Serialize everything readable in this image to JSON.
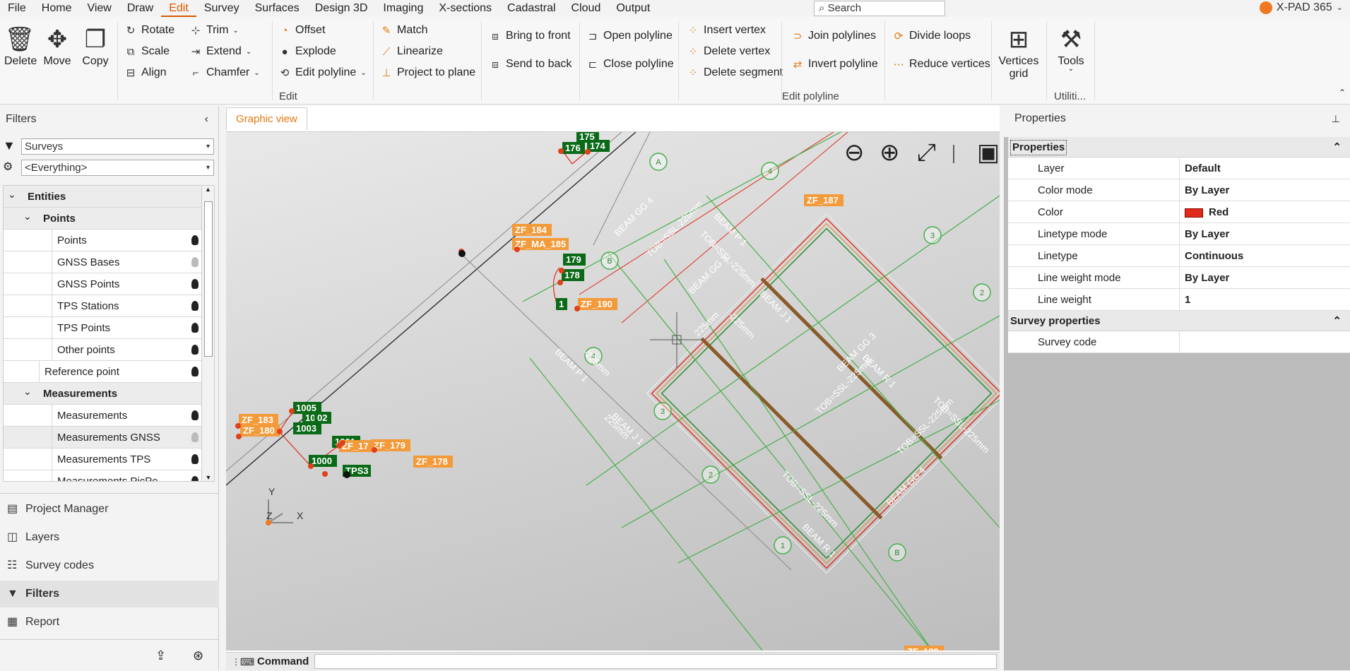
{
  "menu": [
    "File",
    "Home",
    "View",
    "Draw",
    "Edit",
    "Survey",
    "Surfaces",
    "Design 3D",
    "Imaging",
    "X-sections",
    "Cadastral",
    "Cloud",
    "Output"
  ],
  "search_label": "Search",
  "brand": "X-PAD 365",
  "ribbon": {
    "delete": "Delete",
    "move": "Move",
    "copy": "Copy",
    "rotate": "Rotate",
    "scale": "Scale",
    "align": "Align",
    "trim": "Trim",
    "extend": "Extend",
    "chamfer": "Chamfer",
    "offset": "Offset",
    "explode": "Explode",
    "edit_polyline": "Edit polyline",
    "match": "Match",
    "linearize": "Linearize",
    "project_to_plane": "Project to plane",
    "bring_to_front": "Bring to front",
    "send_to_back": "Send to back",
    "open_polyline": "Open polyline",
    "close_polyline": "Close polyline",
    "insert_vertex": "Insert vertex",
    "delete_vertex": "Delete vertex",
    "delete_segment": "Delete segment",
    "join_polylines": "Join polylines",
    "invert_polyline": "Invert polyline",
    "divide_loops": "Divide loops",
    "reduce_vertices": "Reduce vertices",
    "vertices_grid_1": "Vertices",
    "vertices_grid_2": "grid",
    "tools": "Tools",
    "group_edit": "Edit",
    "group_edit_polyline": "Edit polyline",
    "group_utilities": "Utiliti..."
  },
  "filters": {
    "title": "Filters",
    "dropdown1": "Surveys",
    "dropdown2": "<Everything>",
    "tree": [
      {
        "label": "Entities",
        "level": 0,
        "bold": true,
        "expander": true,
        "bulb": "",
        "grey": true
      },
      {
        "label": "Points",
        "level": 1,
        "bold": true,
        "expander": true,
        "bulb": "",
        "grey": true
      },
      {
        "label": "Points",
        "level": 2,
        "bold": false,
        "expander": false,
        "bulb": "on",
        "grey": false
      },
      {
        "label": "GNSS Bases",
        "level": 2,
        "bold": false,
        "expander": false,
        "bulb": "dim",
        "grey": false
      },
      {
        "label": "GNSS Points",
        "level": 2,
        "bold": false,
        "expander": false,
        "bulb": "on",
        "grey": false
      },
      {
        "label": "TPS Stations",
        "level": 2,
        "bold": false,
        "expander": false,
        "bulb": "on",
        "grey": false
      },
      {
        "label": "TPS Points",
        "level": 2,
        "bold": false,
        "expander": false,
        "bulb": "on",
        "grey": false
      },
      {
        "label": "Other points",
        "level": 2,
        "bold": false,
        "expander": false,
        "bulb": "on",
        "grey": false
      },
      {
        "label": "Reference point",
        "level": 1.5,
        "bold": false,
        "expander": false,
        "bulb": "on",
        "grey": false
      },
      {
        "label": "Measurements",
        "level": 1,
        "bold": true,
        "expander": true,
        "bulb": "",
        "grey": true
      },
      {
        "label": "Measurements",
        "level": 2,
        "bold": false,
        "expander": false,
        "bulb": "on",
        "grey": false
      },
      {
        "label": "Measurements GNSS",
        "level": 2,
        "bold": false,
        "expander": false,
        "bulb": "dim",
        "grey": true
      },
      {
        "label": "Measurements TPS",
        "level": 2,
        "bold": false,
        "expander": false,
        "bulb": "on",
        "grey": false
      },
      {
        "label": "Measurements PicPo",
        "level": 2,
        "bold": false,
        "expander": false,
        "bulb": "on",
        "grey": false
      }
    ]
  },
  "nav": [
    "Project Manager",
    "Layers",
    "Survey codes",
    "Filters",
    "Report"
  ],
  "nav_selected": "Filters",
  "graphic_tab": "Graphic view",
  "command_label": "Command",
  "properties": {
    "title": "Properties",
    "section1": "Properties",
    "rows": [
      {
        "k": "Layer",
        "v": "Default"
      },
      {
        "k": "Color mode",
        "v": "By Layer"
      },
      {
        "k": "Color",
        "v": "Red"
      },
      {
        "k": "Linetype mode",
        "v": "By Layer"
      },
      {
        "k": "Linetype",
        "v": "Continuous"
      },
      {
        "k": "Line weight mode",
        "v": "By Layer"
      },
      {
        "k": "Line weight",
        "v": "1"
      }
    ],
    "section2": "Survey properties",
    "rows2": [
      {
        "k": "Survey code",
        "v": ""
      }
    ]
  },
  "drawing": {
    "point_labels": [
      "175",
      "176",
      "174",
      "179",
      "178",
      "1005",
      "1004",
      "1003",
      "1001",
      "1000",
      "TPS3",
      "02",
      "1"
    ],
    "orange_labels": [
      "ZF_184",
      "ZF_MA_185",
      "ZF_187",
      "ZF_190",
      "ZF_183",
      "ZF_180",
      "ZF_17",
      "ZF_179",
      "ZF_178",
      "ZF_189"
    ],
    "beam_labels": [
      "BEAM GG 4",
      "TOB=SSL-225mm",
      "BEAM P 1",
      "TOB=SSL-225mm",
      "BEAM J 1",
      "-225mm",
      "BEAM GG 3",
      "225mm",
      "BEAM GG 3",
      "TOB=SSL-225mm",
      "BEAM R 1",
      "TOB=SSL-225mm",
      "BEAM P 1",
      "-225mm",
      "BEAM J 1",
      "225mm",
      "TOB=SSL-225mm",
      "TOB=SSL-225mm",
      "BEAM GG 4",
      "BEAM R 1"
    ],
    "grid_bubbles": [
      "A",
      "4",
      "B",
      "3",
      "2",
      "4",
      "3",
      "2",
      "1",
      "B"
    ],
    "axis": {
      "y": "Y",
      "z": "Z",
      "x": "X"
    }
  },
  "colors": {
    "accent": "#e07a12",
    "red": "#e02b1a",
    "green": "#1e8a2a",
    "label_green": "#0b6a18"
  }
}
